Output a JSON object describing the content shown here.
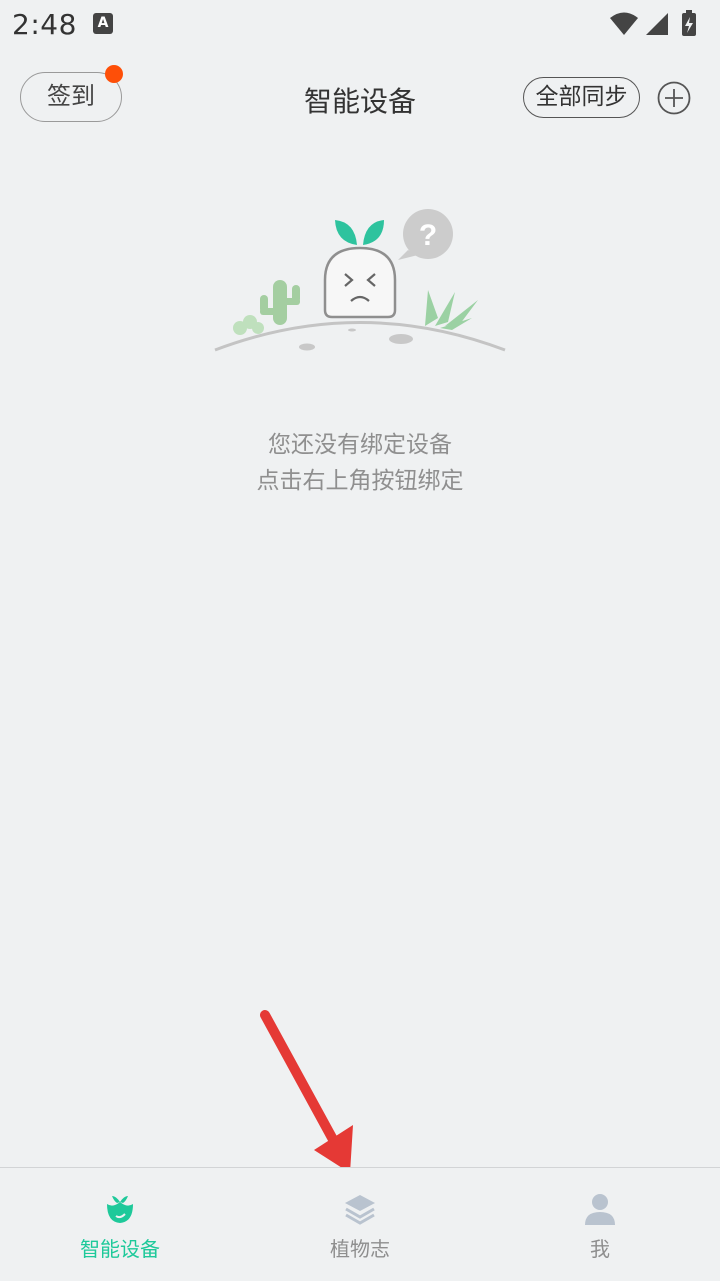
{
  "status_bar": {
    "time": "2:48",
    "notification_icon_letter": "A",
    "icons": [
      "wifi-icon",
      "signal-icon",
      "battery-charging-icon"
    ]
  },
  "header": {
    "checkin_label": "签到",
    "has_notification_dot": true,
    "title": "智能设备",
    "sync_label": "全部同步",
    "add_icon": "plus-circle-icon"
  },
  "empty_state": {
    "illustration": "sprout-character-empty-illustration",
    "line1": "您还没有绑定设备",
    "line2": "点击右上角按钮绑定"
  },
  "tabbar": {
    "tabs": [
      {
        "label": "智能设备",
        "icon": "plant-bud-icon",
        "active": true
      },
      {
        "label": "植物志",
        "icon": "layers-icon",
        "active": false
      },
      {
        "label": "我",
        "icon": "user-icon",
        "active": false
      }
    ]
  },
  "colors": {
    "accent": "#1ec99a",
    "notification_dot": "#fe4f08",
    "background": "#eff1f2",
    "annotation_arrow": "#e53935"
  }
}
